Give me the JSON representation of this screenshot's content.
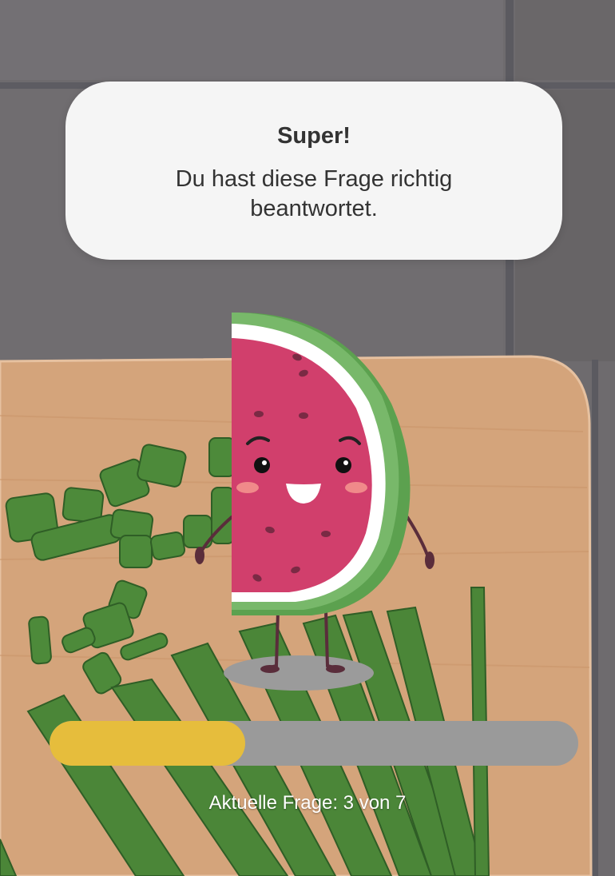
{
  "feedback": {
    "title": "Super!",
    "message": "Du hast diese Frage richtig beantwortet."
  },
  "mascot": {
    "icon": "watermelon-mascot-icon"
  },
  "progress": {
    "label": "Aktuelle Frage: 3 von 7",
    "current": 3,
    "total": 7,
    "fraction": 0.37
  },
  "colors": {
    "progress_fill": "#e6bd3c",
    "progress_track": "#9a9a9a",
    "card_background": "#f5f5f5",
    "text_dark": "#333333",
    "melon_flesh": "#d13f6c",
    "melon_rind": "#5ca14f"
  }
}
